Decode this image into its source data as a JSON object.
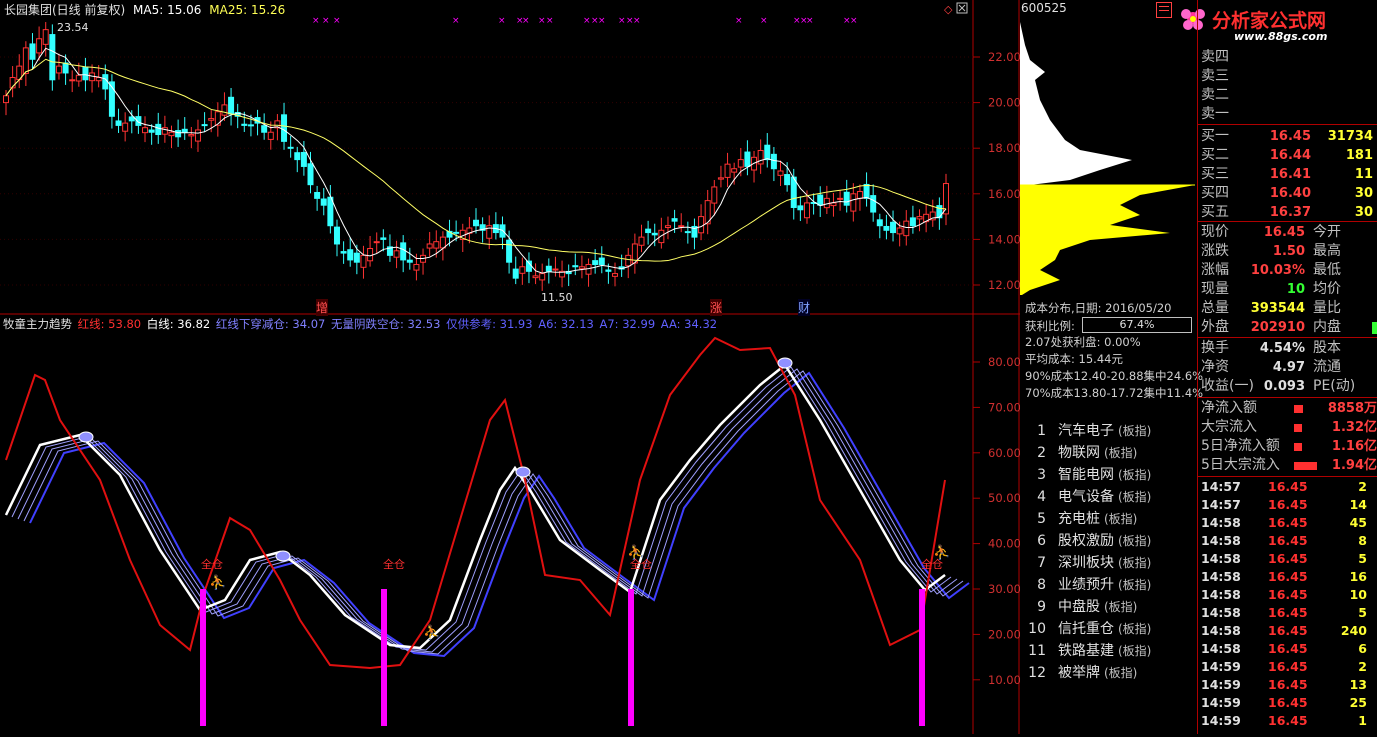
{
  "header": {
    "stock_title": "长园集团(日线 前复权)",
    "ma5_label": "MA5: 15.06",
    "ma25_label": "MA25: 15.26",
    "max_label": "23.54",
    "min_label": "11.50",
    "event_marks": [
      "增",
      "涨",
      "财"
    ]
  },
  "indicator": {
    "name": "牧童主力趋势",
    "red_label": "红线: 53.80",
    "white_label": "白线: 36.82",
    "cross_label": "红线下穿减仓: 34.07",
    "noshadow_label": "无量阴跌空仓: 32.53",
    "ref_label": "仅供参考: 31.93",
    "a6_label": "A6: 32.13",
    "a7_label": "A7: 32.99",
    "aa_label": "AA: 34.32",
    "buy_label": "全仓"
  },
  "price_axis": [
    "22.00",
    "20.00",
    "18.00",
    "16.00",
    "14.00",
    "12.00"
  ],
  "indicator_axis": [
    "80.00",
    "70.00",
    "60.00",
    "50.00",
    "40.00",
    "30.00",
    "20.00",
    "10.00"
  ],
  "chip": {
    "code": "600525",
    "title": "成本分布,日期: 2016/05/20",
    "profit_label": "获利比例:",
    "profit_value": "67.4%",
    "profit_ratio": 0.674,
    "line1": "2.07处获利盘: 0.00%",
    "line2": "平均成本: 15.44元",
    "line3": "90%成本12.40-20.88集中24.6%",
    "line4": "70%成本13.80-17.72集中11.4%"
  },
  "sectors": [
    {
      "no": "1",
      "name": "汽车电子",
      "tag": "(板指)"
    },
    {
      "no": "2",
      "name": "物联网",
      "tag": "(板指)"
    },
    {
      "no": "3",
      "name": "智能电网",
      "tag": "(板指)"
    },
    {
      "no": "4",
      "name": "电气设备",
      "tag": "(板指)"
    },
    {
      "no": "5",
      "name": "充电桩",
      "tag": "(板指)"
    },
    {
      "no": "6",
      "name": "股权激励",
      "tag": "(板指)"
    },
    {
      "no": "7",
      "name": "深圳板块",
      "tag": "(板指)"
    },
    {
      "no": "8",
      "name": "业绩预升",
      "tag": "(板指)"
    },
    {
      "no": "9",
      "name": "中盘股",
      "tag": "(板指)"
    },
    {
      "no": "10",
      "name": "信托重仓",
      "tag": "(板指)"
    },
    {
      "no": "11",
      "name": "铁路基建",
      "tag": "(板指)"
    },
    {
      "no": "12",
      "name": "被举牌",
      "tag": "(板指)"
    }
  ],
  "logo": {
    "main": "分析家公式网",
    "url": "www.88gs.com"
  },
  "order_book": {
    "sell": [
      "卖四",
      "卖三",
      "卖二",
      "卖一"
    ],
    "buy": [
      {
        "label": "买一",
        "price": "16.45",
        "vol": "31734"
      },
      {
        "label": "买二",
        "price": "16.44",
        "vol": "181"
      },
      {
        "label": "买三",
        "price": "16.41",
        "vol": "11"
      },
      {
        "label": "买四",
        "price": "16.40",
        "vol": "30"
      },
      {
        "label": "买五",
        "price": "16.37",
        "vol": "30"
      }
    ]
  },
  "quote": [
    {
      "label": "现价",
      "value": "16.45",
      "label2": "今开",
      "cls": "red"
    },
    {
      "label": "涨跌",
      "value": "1.50",
      "label2": "最高",
      "cls": "red"
    },
    {
      "label": "涨幅",
      "value": "10.03%",
      "label2": "最低",
      "cls": "red"
    },
    {
      "label": "现量",
      "value": "10",
      "label2": "均价",
      "cls": "grn"
    },
    {
      "label": "总量",
      "value": "393544",
      "label2": "量比",
      "cls": "yel"
    },
    {
      "label": "外盘",
      "value": "202910",
      "label2": "内盘",
      "cls": "red"
    }
  ],
  "stats": [
    {
      "label": "换手",
      "value": "4.54%",
      "label2": "股本"
    },
    {
      "label": "净资",
      "value": "4.97",
      "label2": "流通"
    },
    {
      "label": "收益(一)",
      "value": "0.093",
      "label2": "PE(动)"
    }
  ],
  "flows": [
    {
      "label": "净流入额",
      "value": "8858万",
      "bar": 0.35
    },
    {
      "label": "大宗流入",
      "value": "1.32亿",
      "bar": 0.3
    },
    {
      "label": "5日净流入额",
      "value": "1.16亿",
      "bar": 0.3
    },
    {
      "label": "5日大宗流入",
      "value": "1.94亿",
      "bar": 0.9
    }
  ],
  "ticks": [
    {
      "t": "14:57",
      "p": "16.45",
      "v": "2"
    },
    {
      "t": "14:57",
      "p": "16.45",
      "v": "14"
    },
    {
      "t": "14:58",
      "p": "16.45",
      "v": "45"
    },
    {
      "t": "14:58",
      "p": "16.45",
      "v": "8"
    },
    {
      "t": "14:58",
      "p": "16.45",
      "v": "5"
    },
    {
      "t": "14:58",
      "p": "16.45",
      "v": "16"
    },
    {
      "t": "14:58",
      "p": "16.45",
      "v": "10"
    },
    {
      "t": "14:58",
      "p": "16.45",
      "v": "5"
    },
    {
      "t": "14:58",
      "p": "16.45",
      "v": "240"
    },
    {
      "t": "14:58",
      "p": "16.45",
      "v": "6"
    },
    {
      "t": "14:59",
      "p": "16.45",
      "v": "2"
    },
    {
      "t": "14:59",
      "p": "16.45",
      "v": "13"
    },
    {
      "t": "14:59",
      "p": "16.45",
      "v": "25"
    },
    {
      "t": "14:59",
      "p": "16.45",
      "v": "1"
    }
  ],
  "colors": {
    "up": "#ff3333",
    "down": "#33ffff",
    "ma5": "#ffffff",
    "ma25": "#ffff66",
    "red_line": "#e01010",
    "blue_band": "#4040ff",
    "signal": "#ff00ff"
  }
}
